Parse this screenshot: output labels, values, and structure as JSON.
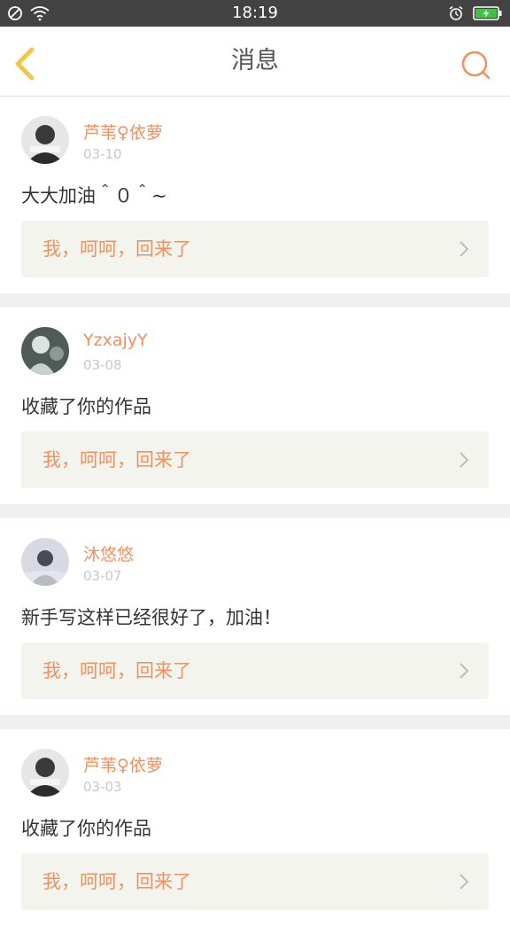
{
  "status_bar": {
    "time": "18:19"
  },
  "nav": {
    "title": "消息",
    "back_icon": "chevron-left-icon",
    "search_icon": "search-icon"
  },
  "colors": {
    "accent": "#f0915f",
    "back_icon": "#f0c64a",
    "status_bar": "#434343",
    "quote_bg": "#f4f4ee"
  },
  "messages": [
    {
      "user": "芦苇♀依萝",
      "date": "03-10",
      "content": "大大加油＾０＾~",
      "quote": "我，呵呵，回来了"
    },
    {
      "user": "YzxajyY",
      "date": "03-08",
      "content": "收藏了你的作品",
      "quote": "我，呵呵，回来了"
    },
    {
      "user": "沐悠悠",
      "date": "03-07",
      "content": "新手写这样已经很好了，加油！",
      "quote": "我，呵呵，回来了"
    },
    {
      "user": "芦苇♀依萝",
      "date": "03-03",
      "content": "收藏了你的作品",
      "quote": "我，呵呵，回来了"
    }
  ]
}
